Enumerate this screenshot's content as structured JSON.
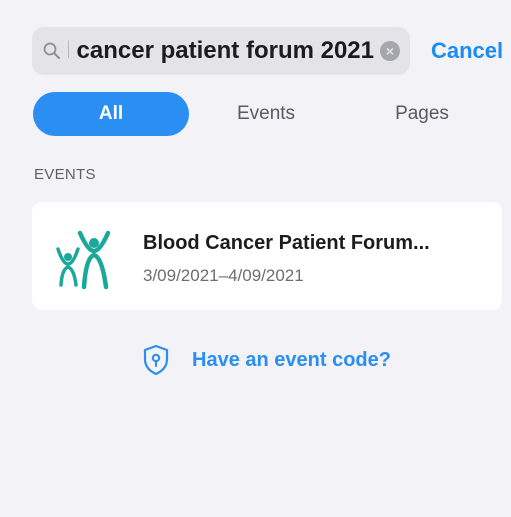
{
  "search": {
    "query": "l cancer patient forum 2021",
    "cancel_label": "Cancel"
  },
  "tabs": [
    {
      "label": "All",
      "selected": true
    },
    {
      "label": "Events",
      "selected": false
    },
    {
      "label": "Pages",
      "selected": false
    }
  ],
  "results": {
    "section_header": "EVENTS",
    "events": [
      {
        "title": "Blood Cancer Patient Forum...",
        "dates": "3/09/2021–4/09/2021",
        "logo_icon": "people-cheering-icon"
      }
    ]
  },
  "event_code": {
    "label": "Have an event code?",
    "icon": "shield-question-icon"
  },
  "colors": {
    "accent": "#2b8ef2",
    "logo_teal": "#1aa89a",
    "background": "#f2f2f7"
  }
}
